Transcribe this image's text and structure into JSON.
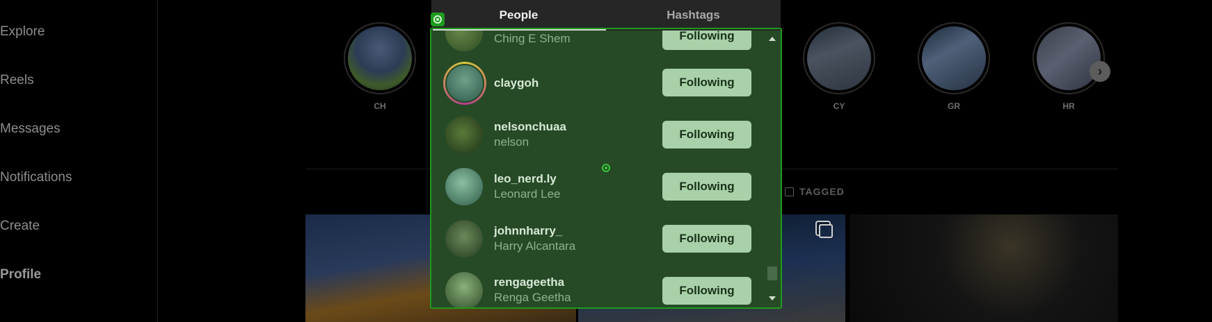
{
  "sidebar": {
    "items": [
      {
        "label": "Explore"
      },
      {
        "label": "Reels"
      },
      {
        "label": "Messages"
      },
      {
        "label": "Notifications"
      },
      {
        "label": "Create"
      },
      {
        "label": "Profile"
      }
    ]
  },
  "highlights": [
    {
      "label": "CH"
    },
    {
      "label": "CY"
    },
    {
      "label": "GR"
    },
    {
      "label": "HR"
    }
  ],
  "tabs": {
    "tagged": "TAGGED"
  },
  "modal": {
    "tabs": [
      {
        "label": "People"
      },
      {
        "label": "Hashtags"
      }
    ],
    "people": [
      {
        "username": "",
        "fullname": "Ching E Shem",
        "button": "Following"
      },
      {
        "username": "claygoh",
        "fullname": "",
        "button": "Following"
      },
      {
        "username": "nelsonchuaa",
        "fullname": "nelson",
        "button": "Following"
      },
      {
        "username": "leo_nerd.ly",
        "fullname": "Leonard Lee",
        "button": "Following"
      },
      {
        "username": "johnnharry_",
        "fullname": "Harry Alcantara",
        "button": "Following"
      },
      {
        "username": "rengageetha",
        "fullname": "Renga Geetha",
        "button": "Following"
      }
    ]
  },
  "colors": {
    "modal_bg": "#264a26",
    "focus_border": "#1e9a1e",
    "button_bg": "#a9d1a9"
  },
  "icons": [
    "target-icon",
    "chevron-right-icon",
    "tag-person-icon",
    "multi-post-icon",
    "scroll-up-icon",
    "scroll-down-icon"
  ]
}
